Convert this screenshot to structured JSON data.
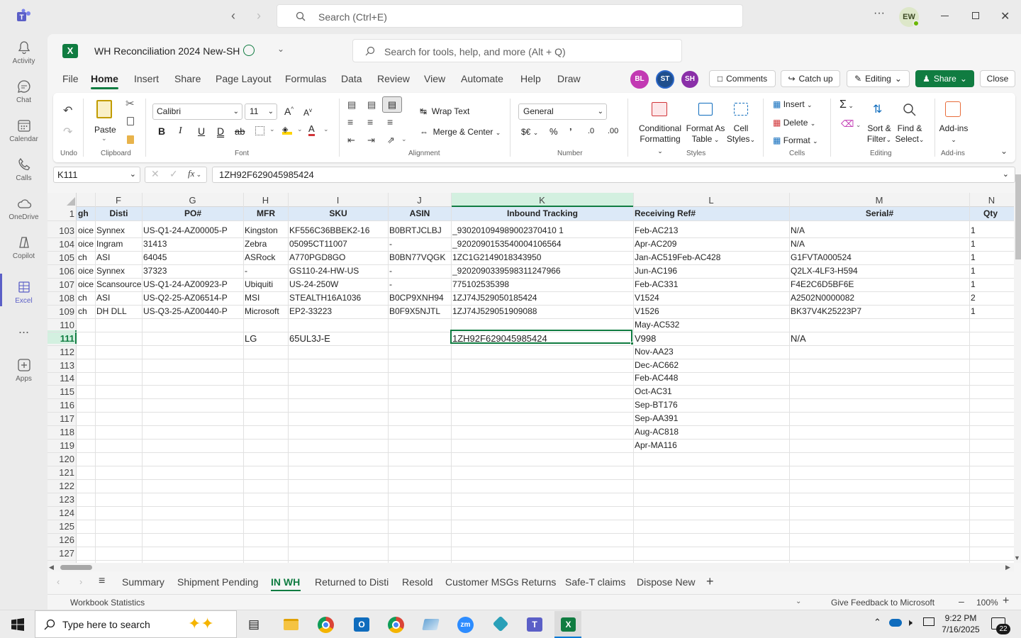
{
  "teams": {
    "search_placeholder": "Search (Ctrl+E)",
    "avatar": "EW",
    "more": "···"
  },
  "rail": [
    {
      "label": "Activity",
      "icon": "bell-icon"
    },
    {
      "label": "Chat",
      "icon": "chat-icon"
    },
    {
      "label": "Calendar",
      "icon": "calendar-icon"
    },
    {
      "label": "Calls",
      "icon": "phone-icon"
    },
    {
      "label": "OneDrive",
      "icon": "cloud-icon"
    },
    {
      "label": "Copilot",
      "icon": "copilot-icon"
    },
    {
      "label": "Excel",
      "icon": "excel-icon"
    },
    {
      "label": "...",
      "icon": "more-icon"
    },
    {
      "label": "Apps",
      "icon": "apps-icon"
    }
  ],
  "excel": {
    "title": "WH Reconciliation 2024 New-SH",
    "search_placeholder": "Search for tools, help, and more (Alt + Q)"
  },
  "tabs": [
    "File",
    "Home",
    "Insert",
    "Share",
    "Page Layout",
    "Formulas",
    "Data",
    "Review",
    "View",
    "Automate",
    "Help",
    "Draw"
  ],
  "collab": {
    "avatars": [
      {
        "initials": "BL",
        "color": "#c239b3"
      },
      {
        "initials": "ST",
        "color": "#1f4e8c"
      },
      {
        "initials": "SH",
        "color": "#8a2fa8"
      }
    ],
    "comments": "Comments",
    "catchup": "Catch up",
    "editing": "Editing",
    "share": "Share",
    "close": "Close"
  },
  "ribbon": {
    "undo": "Undo",
    "paste": "Paste",
    "clipboard": "Clipboard",
    "font_name": "Calibri",
    "font_size": "11",
    "font": "Font",
    "wrap": "Wrap Text",
    "merge": "Merge & Center",
    "alignment": "Alignment",
    "num_format": "General",
    "number": "Number",
    "cond1": "Conditional",
    "cond2": "Formatting",
    "fmt1": "Format As",
    "fmt2": "Table",
    "cs1": "Cell",
    "cs2": "Styles",
    "styles": "Styles",
    "insert": "Insert",
    "delete": "Delete",
    "format": "Format",
    "cells": "Cells",
    "sort1": "Sort &",
    "sort2": "Filter",
    "find1": "Find &",
    "find2": "Select",
    "editing": "Editing",
    "addins": "Add-ins",
    "addins_group": "Add-ins"
  },
  "formula": {
    "name_box": "K111",
    "fx": "fx",
    "value": "1ZH92F629045985424"
  },
  "columns": [
    {
      "letter": "F"
    },
    {
      "letter": "G"
    },
    {
      "letter": "H"
    },
    {
      "letter": "I"
    },
    {
      "letter": "J"
    },
    {
      "letter": "K"
    },
    {
      "letter": "L"
    },
    {
      "letter": "M"
    },
    {
      "letter": "N"
    }
  ],
  "header_row": {
    "num": "1",
    "cells": [
      "gh",
      "Disti",
      "PO#",
      "MFR",
      "SKU",
      "ASIN",
      "Inbound Tracking",
      "Receiving Ref#",
      "Serial#",
      "Qty"
    ]
  },
  "rows": [
    {
      "num": "103",
      "cells": [
        "oice",
        "Synnex",
        "US-Q1-24-AZ00005-P",
        "Kingston",
        "KF556C36BBEK2-16",
        "B0BRTJCLBJ",
        "_930201094989002370410 1",
        "Feb-AC213",
        "N/A",
        "1"
      ]
    },
    {
      "num": "104",
      "cells": [
        "oice",
        "Ingram",
        "31413",
        "Zebra",
        "05095CT11007",
        "-",
        "_9202090153540004106564",
        "Apr-AC209",
        "N/A",
        "1"
      ]
    },
    {
      "num": "105",
      "cells": [
        "ch",
        "ASI",
        "64045",
        "ASRock",
        "A770PGD8GO",
        "B0BN77VQGK",
        "1ZC1G2149018343950",
        "Jan-AC519Feb-AC428",
        "G1FVTA000524",
        "1"
      ]
    },
    {
      "num": "106",
      "cells": [
        "oice",
        "Synnex",
        "37323",
        "-",
        "GS110-24-HW-US",
        "-",
        "_9202090339598311247966",
        "Jun-AC196",
        "Q2LX-4LF3-H594",
        "1"
      ]
    },
    {
      "num": "107",
      "cells": [
        "oice",
        "Scansource",
        "US-Q1-24-AZ00923-P",
        "Ubiquiti",
        "US-24-250W",
        "-",
        "775102535398",
        "Feb-AC331",
        "F4E2C6D5BF6E",
        "1"
      ]
    },
    {
      "num": "108",
      "cells": [
        "ch",
        "ASI",
        "US-Q2-25-AZ06514-P",
        "MSI",
        "STEALTH16A1036",
        "B0CP9XNH94",
        "1ZJ74J529050185424",
        "V1524",
        "A2502N0000082",
        "2"
      ]
    },
    {
      "num": "109",
      "cells": [
        "ch",
        "DH DLL",
        "US-Q3-25-AZ00440-P",
        "Microsoft",
        "EP2-33223",
        "B0F9X5NJTL",
        "1ZJ74J529051909088",
        "V1526",
        "BK37V4K25223P7",
        "1"
      ]
    },
    {
      "num": "110",
      "cells": [
        "",
        "",
        "",
        "",
        "",
        "",
        "",
        "May-AC532",
        "",
        ""
      ]
    },
    {
      "num": "111",
      "cells": [
        "",
        "",
        "",
        "LG",
        "65UL3J-E",
        "",
        "1ZH92F629045985424",
        "V998",
        "N/A",
        ""
      ]
    },
    {
      "num": "112",
      "cells": [
        "",
        "",
        "",
        "",
        "",
        "",
        "",
        "Nov-AA23",
        "",
        ""
      ]
    },
    {
      "num": "113",
      "cells": [
        "",
        "",
        "",
        "",
        "",
        "",
        "",
        "Dec-AC662",
        "",
        ""
      ]
    },
    {
      "num": "114",
      "cells": [
        "",
        "",
        "",
        "",
        "",
        "",
        "",
        "Feb-AC448",
        "",
        ""
      ]
    },
    {
      "num": "115",
      "cells": [
        "",
        "",
        "",
        "",
        "",
        "",
        "",
        "Oct-AC31",
        "",
        ""
      ]
    },
    {
      "num": "116",
      "cells": [
        "",
        "",
        "",
        "",
        "",
        "",
        "",
        "Sep-BT176",
        "",
        ""
      ]
    },
    {
      "num": "117",
      "cells": [
        "",
        "",
        "",
        "",
        "",
        "",
        "",
        "Sep-AA391",
        "",
        ""
      ]
    },
    {
      "num": "118",
      "cells": [
        "",
        "",
        "",
        "",
        "",
        "",
        "",
        "Aug-AC818",
        "",
        ""
      ]
    },
    {
      "num": "119",
      "cells": [
        "",
        "",
        "",
        "",
        "",
        "",
        "",
        "Apr-MA116",
        "",
        ""
      ]
    },
    {
      "num": "120",
      "cells": [
        "",
        "",
        "",
        "",
        "",
        "",
        "",
        "",
        "",
        ""
      ]
    },
    {
      "num": "121",
      "cells": [
        "",
        "",
        "",
        "",
        "",
        "",
        "",
        "",
        "",
        ""
      ]
    },
    {
      "num": "122",
      "cells": [
        "",
        "",
        "",
        "",
        "",
        "",
        "",
        "",
        "",
        ""
      ]
    },
    {
      "num": "123",
      "cells": [
        "",
        "",
        "",
        "",
        "",
        "",
        "",
        "",
        "",
        ""
      ]
    },
    {
      "num": "124",
      "cells": [
        "",
        "",
        "",
        "",
        "",
        "",
        "",
        "",
        "",
        ""
      ]
    },
    {
      "num": "125",
      "cells": [
        "",
        "",
        "",
        "",
        "",
        "",
        "",
        "",
        "",
        ""
      ]
    },
    {
      "num": "126",
      "cells": [
        "",
        "",
        "",
        "",
        "",
        "",
        "",
        "",
        "",
        ""
      ]
    },
    {
      "num": "127",
      "cells": [
        "",
        "",
        "",
        "",
        "",
        "",
        "",
        "",
        "",
        ""
      ]
    }
  ],
  "sheets": [
    "Summary",
    "Shipment Pending",
    "IN WH",
    "Returned to Disti",
    "Resold",
    "Customer MSGs Returns",
    "Safe-T claims",
    "Dispose New"
  ],
  "active_sheet": "IN WH",
  "status": {
    "left": "Workbook Statistics",
    "feedback": "Give Feedback to Microsoft",
    "zoom": "100%"
  },
  "taskbar": {
    "search": "Type here to search",
    "time": "9:22 PM",
    "date": "7/16/2025",
    "notif": "22"
  }
}
